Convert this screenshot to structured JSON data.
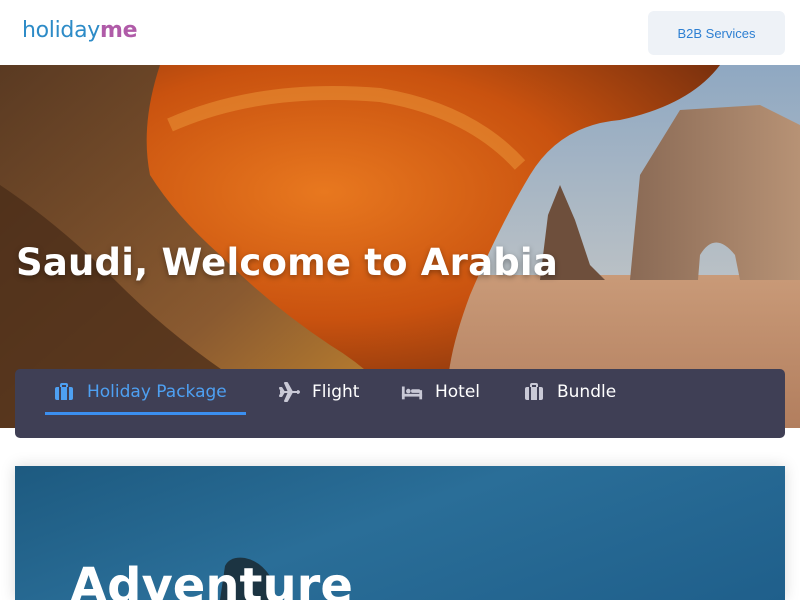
{
  "header": {
    "logo_part1": "holiday",
    "logo_part2": "me",
    "b2b_label": "B2B Services"
  },
  "hero": {
    "title": "Saudi, Welcome to Arabia"
  },
  "tabs": [
    {
      "label": "Holiday Package",
      "icon": "suitcase-icon",
      "active": true
    },
    {
      "label": "Flight",
      "icon": "plane-icon",
      "active": false
    },
    {
      "label": "Hotel",
      "icon": "bed-icon",
      "active": false
    },
    {
      "label": "Bundle",
      "icon": "briefcase-icon",
      "active": false
    }
  ],
  "banner": {
    "title": "Adventure"
  },
  "colors": {
    "brand_blue": "#2d8bc7",
    "brand_purple": "#b05ba8",
    "tab_bar": "#3f3f55",
    "active_tab": "#4ea0f2"
  }
}
